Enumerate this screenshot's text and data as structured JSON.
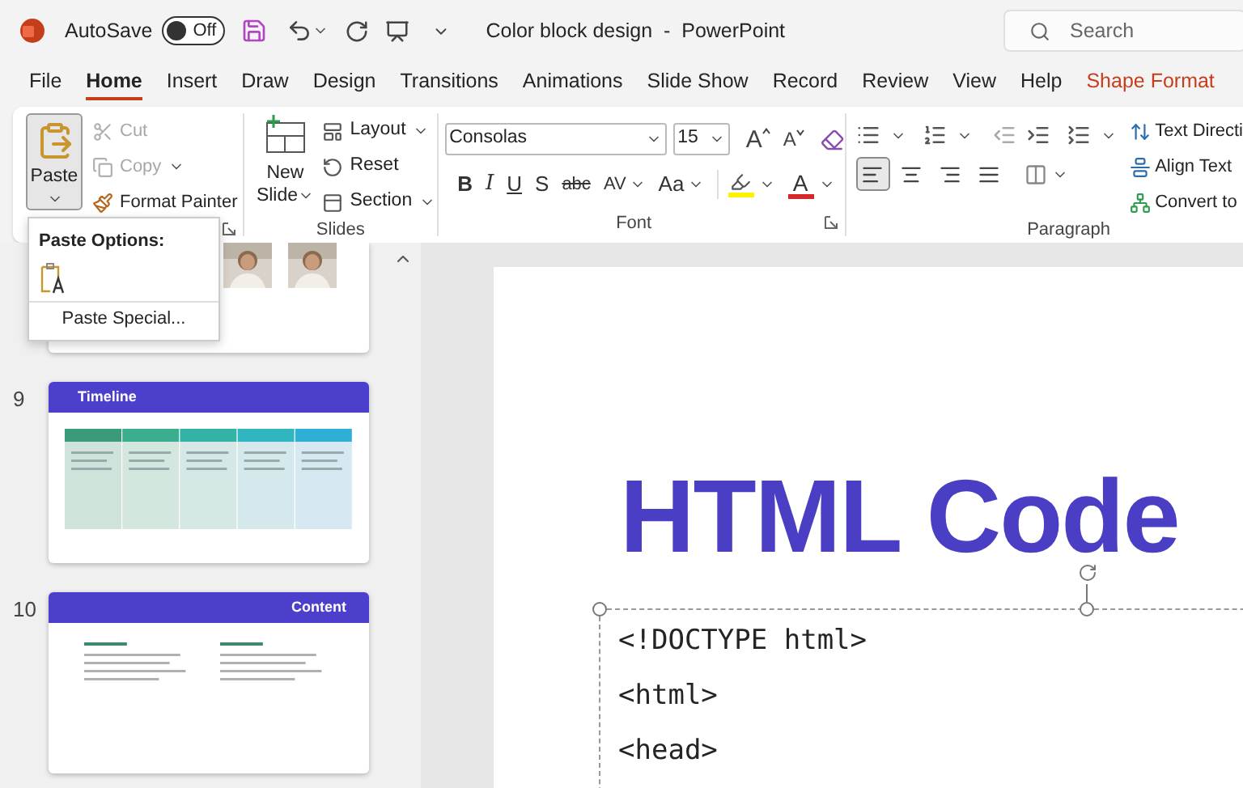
{
  "titlebar": {
    "autosave_label": "AutoSave",
    "autosave": {
      "label": "Off",
      "on": false
    },
    "title": "Color block design  -  PowerPoint",
    "search": {
      "placeholder": "Search"
    }
  },
  "tabs": [
    {
      "label": "File",
      "selected": false,
      "kind": "normal"
    },
    {
      "label": "Home",
      "selected": true,
      "kind": "normal"
    },
    {
      "label": "Insert",
      "selected": false,
      "kind": "normal"
    },
    {
      "label": "Draw",
      "selected": false,
      "kind": "normal"
    },
    {
      "label": "Design",
      "selected": false,
      "kind": "normal"
    },
    {
      "label": "Transitions",
      "selected": false,
      "kind": "normal"
    },
    {
      "label": "Animations",
      "selected": false,
      "kind": "normal"
    },
    {
      "label": "Slide Show",
      "selected": false,
      "kind": "normal"
    },
    {
      "label": "Record",
      "selected": false,
      "kind": "normal"
    },
    {
      "label": "Review",
      "selected": false,
      "kind": "normal"
    },
    {
      "label": "View",
      "selected": false,
      "kind": "normal"
    },
    {
      "label": "Help",
      "selected": false,
      "kind": "normal"
    },
    {
      "label": "Shape Format",
      "selected": false,
      "kind": "contextual"
    }
  ],
  "clipboard": {
    "paste": {
      "label": "Paste",
      "expanded": true
    },
    "small": [
      {
        "kind": "cut",
        "label": "Cut",
        "disabled": true
      },
      {
        "kind": "copy",
        "label": "Copy",
        "disabled": true
      },
      {
        "kind": "painter",
        "label": "Format Painter",
        "disabled": false
      }
    ]
  },
  "slides_group": {
    "label": "Slides",
    "new_slide": [
      "New",
      "Slide"
    ],
    "small": [
      {
        "kind": "layout",
        "label": "Layout"
      },
      {
        "kind": "reset",
        "label": "Reset"
      },
      {
        "kind": "section",
        "label": "Section"
      }
    ]
  },
  "font_group": {
    "label": "Font",
    "font": "Consolas",
    "size": "15",
    "grow": "A",
    "shrink": "A",
    "styles": [
      {
        "kind": "bold",
        "label": "B"
      },
      {
        "kind": "italic",
        "label": "I"
      },
      {
        "kind": "underline",
        "label": "U"
      },
      {
        "kind": "shadow",
        "label": "S"
      },
      {
        "kind": "strike",
        "label": "abc"
      },
      {
        "kind": "spacing",
        "label": "AV"
      },
      {
        "kind": "case",
        "label": "Aa"
      }
    ],
    "font_color_label": "A"
  },
  "paragraph_group": {
    "label": "Paragraph",
    "align": [
      {
        "kind": "left",
        "selected": true
      },
      {
        "kind": "center",
        "selected": false
      },
      {
        "kind": "right",
        "selected": false
      },
      {
        "kind": "justify",
        "selected": false
      }
    ],
    "side": [
      {
        "kind": "direction",
        "label": "Text Directi"
      },
      {
        "kind": "align",
        "label": "Align Text"
      },
      {
        "kind": "smartart",
        "label": "Convert to"
      }
    ]
  },
  "paste_menu": {
    "title": "Paste Options:",
    "item": "Paste Special..."
  },
  "thumbnails": [
    {
      "kind": "people"
    },
    {
      "kind": "timeline",
      "number": "9",
      "title": "Timeline"
    },
    {
      "kind": "content",
      "number": "10",
      "title": "Content"
    }
  ],
  "slide": {
    "title": "HTML Code",
    "code_lines": [
      "<!DOCTYPE html>",
      "<html>",
      "<head>"
    ]
  }
}
